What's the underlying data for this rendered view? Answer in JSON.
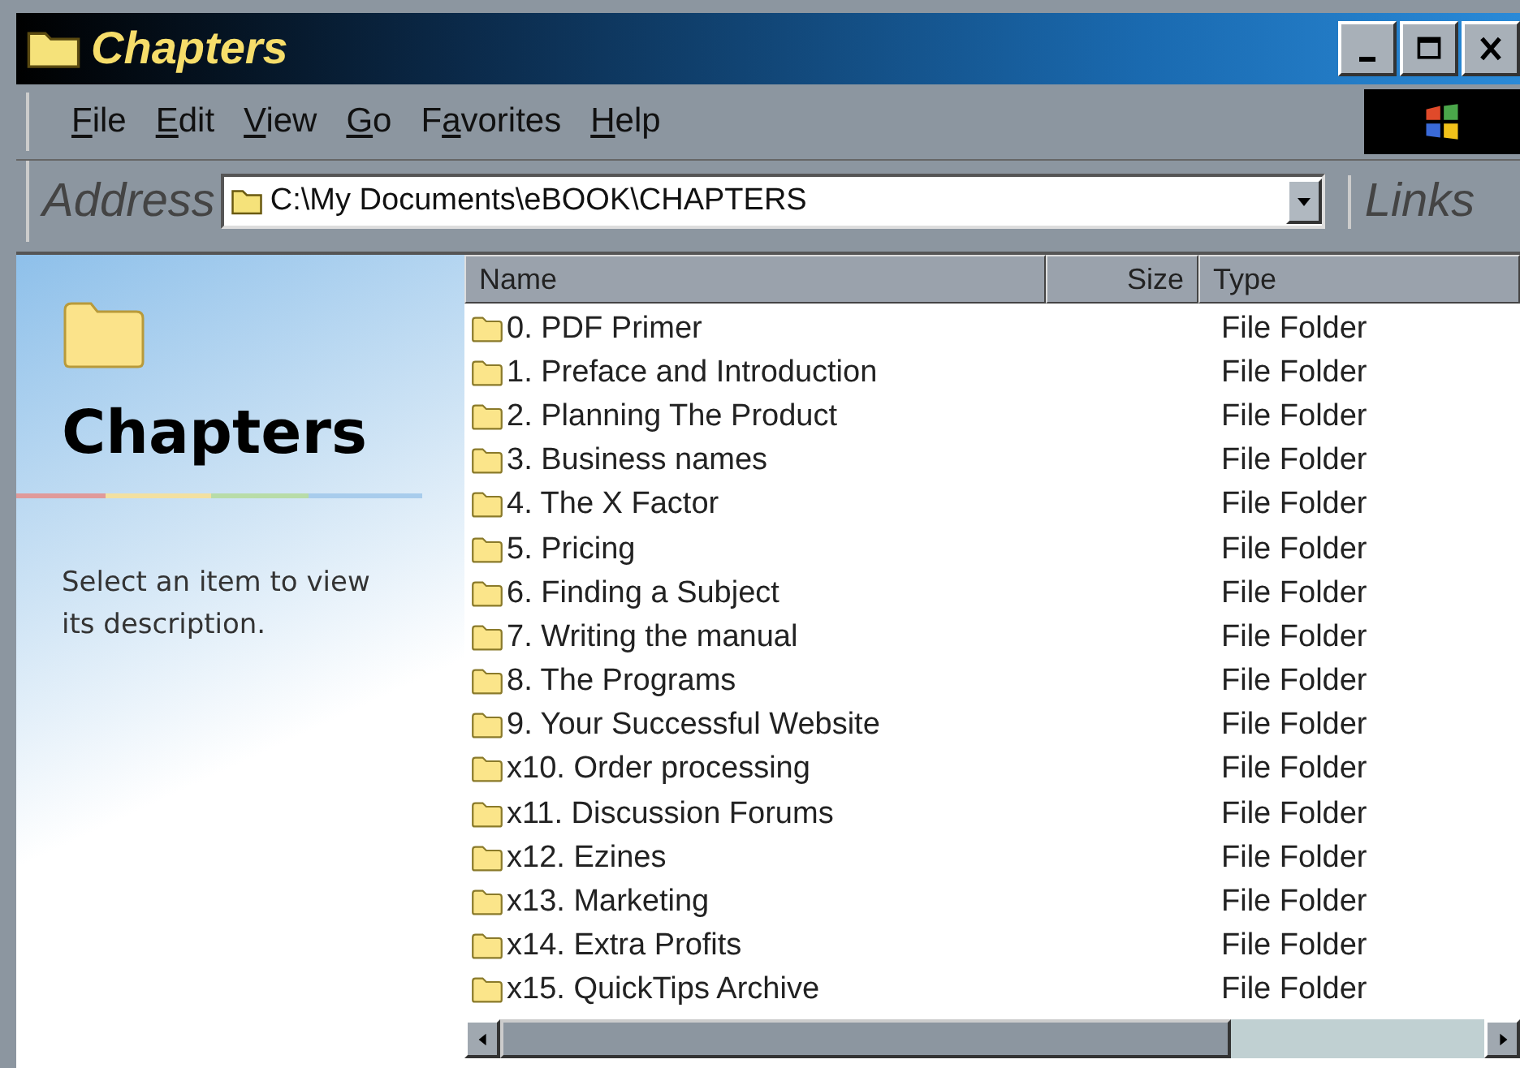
{
  "window": {
    "title": "Chapters"
  },
  "menu": [
    {
      "key": "F",
      "rest": "ile"
    },
    {
      "key": "E",
      "rest": "dit"
    },
    {
      "key": "V",
      "rest": "iew"
    },
    {
      "key": "G",
      "rest": "o"
    },
    {
      "lead": "F",
      "key": "a",
      "rest": "vorites"
    },
    {
      "key": "H",
      "rest": "elp"
    }
  ],
  "address": {
    "label": "Address",
    "value": "C:\\My Documents\\eBOOK\\CHAPTERS",
    "links": "Links"
  },
  "sidebar": {
    "title": "Chapters",
    "description": "Select an item to view its description."
  },
  "table": {
    "columns": [
      "Name",
      "Size",
      "Type"
    ],
    "rows": [
      {
        "name": "0. PDF Primer",
        "type": "File Folder"
      },
      {
        "name": "1. Preface and Introduction",
        "type": "File Folder"
      },
      {
        "name": "2. Planning The Product",
        "type": "File Folder"
      },
      {
        "name": "3. Business names",
        "type": "File Folder"
      },
      {
        "name": "4. The X Factor",
        "type": "File Folder"
      },
      {
        "name": "5. Pricing",
        "type": "File Folder"
      },
      {
        "name": "6. Finding a Subject",
        "type": "File Folder"
      },
      {
        "name": "7. Writing the manual",
        "type": "File Folder"
      },
      {
        "name": "8. The Programs",
        "type": "File Folder"
      },
      {
        "name": "9. Your Successful Website",
        "type": "File Folder"
      },
      {
        "name": "x10. Order processing",
        "type": "File Folder"
      },
      {
        "name": "x11. Discussion Forums",
        "type": "File Folder"
      },
      {
        "name": "x12. Ezines",
        "type": "File Folder"
      },
      {
        "name": "x13. Marketing",
        "type": "File Folder"
      },
      {
        "name": "x14. Extra Profits",
        "type": "File Folder"
      },
      {
        "name": "x15. QuickTips Archive",
        "type": "File Folder"
      }
    ]
  }
}
